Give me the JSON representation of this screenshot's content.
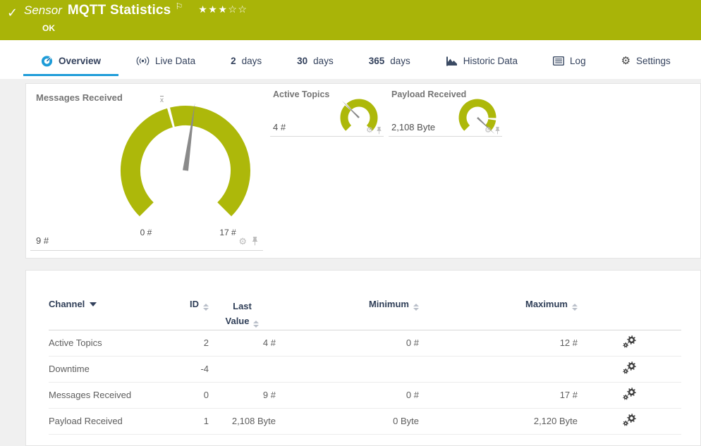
{
  "header": {
    "type_label": "Sensor",
    "title": "MQTT Statistics",
    "status": "OK",
    "rating": {
      "filled": 3,
      "empty": 2
    }
  },
  "icons": {
    "check": "✓",
    "flag": "⚐",
    "star_filled": "★",
    "star_empty": "☆",
    "gear": "⚙"
  },
  "colors": {
    "brand_green": "#a9b408",
    "gauge_green": "#adb80a",
    "needle_gray": "#8a8a8a",
    "accent_blue": "#1e9cd8",
    "navy": "#33415c"
  },
  "tabs": {
    "overview": "Overview",
    "live_data": "Live Data",
    "days2_num": "2",
    "days2_label": "days",
    "days30_num": "30",
    "days30_label": "days",
    "days365_num": "365",
    "days365_label": "days",
    "historic": "Historic Data",
    "log": "Log",
    "settings": "Settings"
  },
  "chart_data": [
    {
      "type": "gauge",
      "title": "Messages Received",
      "value": 9,
      "min": 0,
      "max": 17,
      "value_label": "9 #",
      "min_label": "0 #",
      "max_label": "17 #",
      "avg_fraction": 0.444,
      "avg_symbol": "x"
    },
    {
      "type": "gauge",
      "title": "Active Topics",
      "value": 4,
      "min": 0,
      "max": 12,
      "value_label": "4 #",
      "avg_fraction": 0.333
    },
    {
      "type": "gauge",
      "title": "Payload Received",
      "value": 2108,
      "min": 0,
      "max": 2120,
      "value_label": "2,108 Byte",
      "avg_fraction": 0.85
    }
  ],
  "table": {
    "headers": {
      "channel": "Channel",
      "id": "ID",
      "last_value": "Last Value",
      "minimum": "Minimum",
      "maximum": "Maximum"
    },
    "rows": [
      {
        "channel": "Active Topics",
        "id": "2",
        "last_value": "4 #",
        "minimum": "0 #",
        "maximum": "12 #"
      },
      {
        "channel": "Downtime",
        "id": "-4",
        "last_value": "",
        "minimum": "",
        "maximum": ""
      },
      {
        "channel": "Messages Received",
        "id": "0",
        "last_value": "9 #",
        "minimum": "0 #",
        "maximum": "17 #"
      },
      {
        "channel": "Payload Received",
        "id": "1",
        "last_value": "2,108 Byte",
        "minimum": "0 Byte",
        "maximum": "2,120 Byte"
      }
    ]
  }
}
